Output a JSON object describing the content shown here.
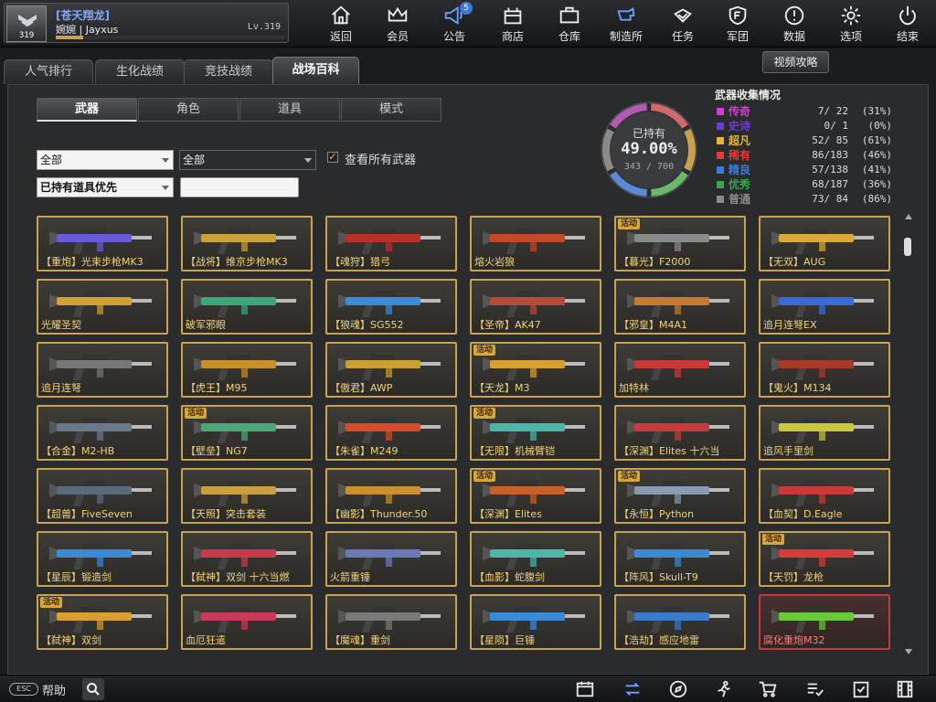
{
  "player": {
    "clan": "[苍天翔龙]",
    "name": "婉婉 | Jayxus",
    "level_text": "Lv.319",
    "avatar_level": "319",
    "exp_fraction": 0.12
  },
  "nav": [
    {
      "label": "返回",
      "icon": "home-icon"
    },
    {
      "label": "会员",
      "icon": "crown-icon"
    },
    {
      "label": "公告",
      "icon": "megaphone-icon",
      "badge": "5"
    },
    {
      "label": "商店",
      "icon": "shop-icon"
    },
    {
      "label": "仓库",
      "icon": "briefcase-icon"
    },
    {
      "label": "制造所",
      "icon": "forge-icon"
    },
    {
      "label": "任务",
      "icon": "task-icon"
    },
    {
      "label": "军团",
      "icon": "shield-icon"
    },
    {
      "label": "数据",
      "icon": "info-icon"
    },
    {
      "label": "选项",
      "icon": "gear-icon"
    },
    {
      "label": "结束",
      "icon": "power-icon"
    }
  ],
  "tabs": [
    "人气排行",
    "生化战绩",
    "竞技战绩",
    "战场百科"
  ],
  "guide_button": "视频攻略",
  "subtabs": [
    "武器",
    "角色",
    "道具",
    "模式"
  ],
  "filters": {
    "category": "全部",
    "subcategory": "全部",
    "sort": "已持有道具优先",
    "search_value": "",
    "view_all_label": "查看所有武器",
    "view_all_checked": true
  },
  "collection": {
    "owned_label": "已持有",
    "percent": "49.00%",
    "count": "343 / 700",
    "title": "武器收集情况",
    "rows": [
      {
        "name": "传奇",
        "value": "7/ 22",
        "pct": "(31%)",
        "color": "#d63bd6"
      },
      {
        "name": "史诗",
        "value": "0/ 1",
        "pct": "(0%)",
        "color": "#6a3bd6"
      },
      {
        "name": "超凡",
        "value": "52/ 85",
        "pct": "(61%)",
        "color": "#e0b53a"
      },
      {
        "name": "稀有",
        "value": "86/183",
        "pct": "(46%)",
        "color": "#e03a3a"
      },
      {
        "name": "精良",
        "value": "57/138",
        "pct": "(41%)",
        "color": "#3a7ae0"
      },
      {
        "name": "优秀",
        "value": "68/187",
        "pct": "(36%)",
        "color": "#3aa84a"
      },
      {
        "name": "普通",
        "value": "73/ 84",
        "pct": "(86%)",
        "color": "#8a8a8a"
      }
    ]
  },
  "cards": [
    {
      "label": "【重炮】光束步枪MK3",
      "color": "#6b5ad8"
    },
    {
      "label": "【战将】维京步枪MK3",
      "color": "#c9a33a"
    },
    {
      "label": "【魂狩】猎弓",
      "color": "#b8302a"
    },
    {
      "label": "熔火岩狼",
      "color": "#c4482a"
    },
    {
      "label": "【暮光】F2000",
      "color": "#8a8a8a",
      "badge": "活动"
    },
    {
      "label": "【无双】AUG",
      "color": "#d8a838"
    },
    {
      "label": "光耀圣契",
      "color": "#d0a030"
    },
    {
      "label": "破军邪眼",
      "color": "#3aa878"
    },
    {
      "label": "【狼魂】SG552",
      "color": "#3a8ad8"
    },
    {
      "label": "【圣帝】AK47",
      "color": "#b84a3a"
    },
    {
      "label": "【邪皇】M4A1",
      "color": "#c87a30"
    },
    {
      "label": "追月连弩EX",
      "color": "#3a6ad8"
    },
    {
      "label": "追月连弩",
      "color": "#777777"
    },
    {
      "label": "【虎王】M95",
      "color": "#c8902a"
    },
    {
      "label": "【傲君】AWP",
      "color": "#c8a030"
    },
    {
      "label": "【天龙】M3",
      "color": "#d8a030",
      "badge": "活动"
    },
    {
      "label": "加特林",
      "color": "#c83a3a"
    },
    {
      "label": "【鬼火】M134",
      "color": "#a83a2a"
    },
    {
      "label": "【合金】M2-HB",
      "color": "#6a7a8a"
    },
    {
      "label": "【壁垒】NG7",
      "color": "#4aa878",
      "badge": "活动"
    },
    {
      "label": "【朱雀】M249",
      "color": "#d84a2a"
    },
    {
      "label": "【无限】机械臂铠",
      "color": "#4ab8a8",
      "badge": "活动"
    },
    {
      "label": "【深渊】Elites 十六当",
      "color": "#c83a3a"
    },
    {
      "label": "追风手里剑",
      "color": "#c8c83a"
    },
    {
      "label": "【超兽】FiveSeven",
      "color": "#5a6a7a"
    },
    {
      "label": "【天照】突击套装",
      "color": "#c8a040"
    },
    {
      "label": "【幽影】Thunder.50",
      "color": "#c89030"
    },
    {
      "label": "【深渊】Elites",
      "color": "#c8602a",
      "badge": "活动"
    },
    {
      "label": "【永恒】Python",
      "color": "#8a9ab0",
      "badge": "活动"
    },
    {
      "label": "【血契】D.Eagle",
      "color": "#c83a3a"
    },
    {
      "label": "【星辰】锻造剑",
      "color": "#3a8ad8"
    },
    {
      "label": "【弑神】双剑 十六当燃",
      "color": "#c83a4a"
    },
    {
      "label": "火箭重锤",
      "color": "#6a7ab8"
    },
    {
      "label": "【血影】蛇腹剑",
      "color": "#4ab8a8"
    },
    {
      "label": "【阵风】Skull-T9",
      "color": "#3a8ad8"
    },
    {
      "label": "【天罚】龙枪",
      "color": "#d83a3a",
      "badge": "活动"
    },
    {
      "label": "【弑神】双剑",
      "color": "#d8a030",
      "badge": "活动"
    },
    {
      "label": "血厄狂遣",
      "color": "#c83a5a"
    },
    {
      "label": "【魔魂】重剑",
      "color": "#7a7a7a"
    },
    {
      "label": "【星陨】巨锤",
      "color": "#3a8ad8"
    },
    {
      "label": "【浩劫】感应地雷",
      "color": "#3a7ac8"
    },
    {
      "label": "腐化重炮M32",
      "color": "#6ac83a",
      "warn": true
    }
  ],
  "bottom": {
    "help_key": "ESC",
    "help_label": "帮助"
  },
  "bottom_icons": [
    "calendar-icon",
    "exchange-icon",
    "compass-icon",
    "runner-icon",
    "cart-icon",
    "list-check-icon",
    "checklist-icon",
    "film-icon"
  ]
}
